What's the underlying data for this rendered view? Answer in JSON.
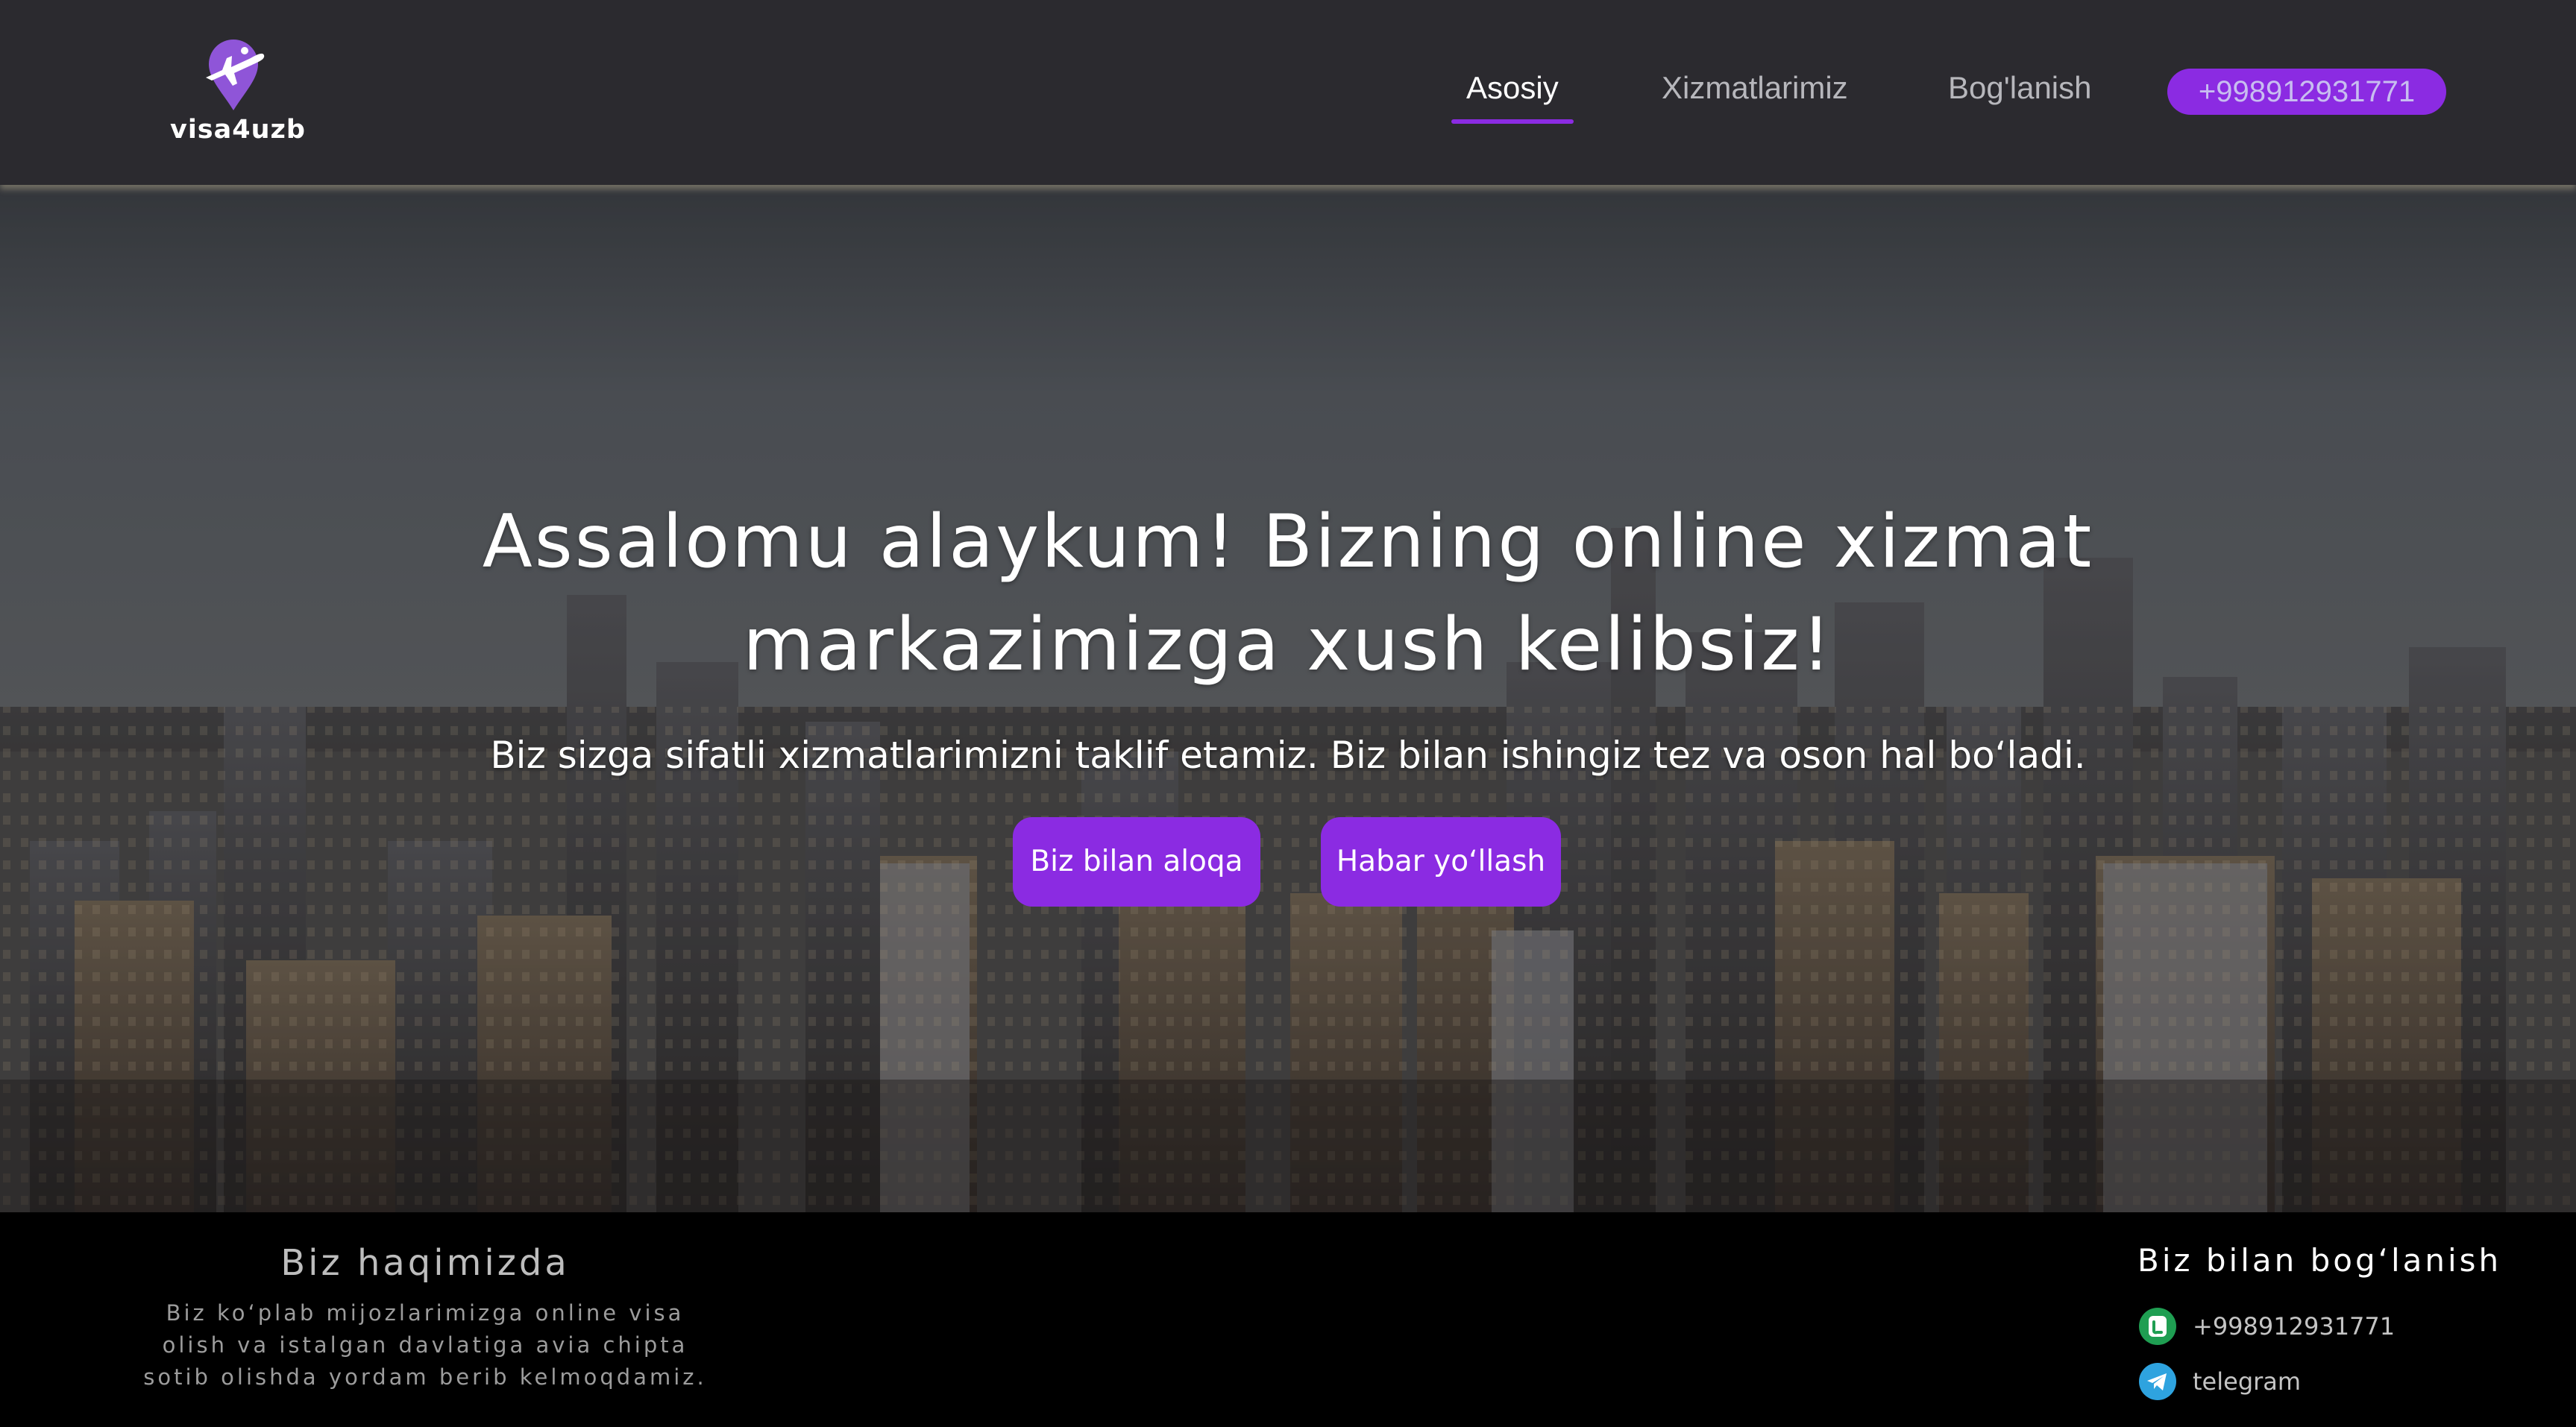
{
  "header": {
    "logo_text": "visa4uzb",
    "nav": {
      "home": "Asosiy",
      "services": "Xizmatlarimiz",
      "contact": "Bog'lanish"
    },
    "phone": "+998912931771"
  },
  "hero": {
    "title": "Assalomu alaykum! Bizning online xizmat markazimizga xush kelibsiz!",
    "subtitle": "Biz sizga sifatli xizmatlarimizni taklif etamiz. Biz bilan ishingiz tez va oson hal bo‘ladi.",
    "buttons": {
      "contact": "Biz bilan aloqa",
      "message": "Habar yo‘llash"
    }
  },
  "footer": {
    "about": {
      "title": "Biz haqimizda",
      "text": "Biz ko‘plab mijozlarimizga online visa olish va istalgan davlatiga avia chipta sotib olishda yordam berib kelmoqdamiz."
    },
    "contact": {
      "title": "Biz bilan bog‘lanish",
      "phone": "+998912931771",
      "telegram": "telegram"
    }
  },
  "colors": {
    "accent": "#8b2be2",
    "header_bg": "#2b2a2f",
    "footer_bg": "#000000",
    "whatsapp_green": "#1f9e52",
    "telegram_blue": "#2ea3df"
  },
  "icons": [
    "plane-location-pin-icon",
    "phone-icon",
    "telegram-icon"
  ]
}
